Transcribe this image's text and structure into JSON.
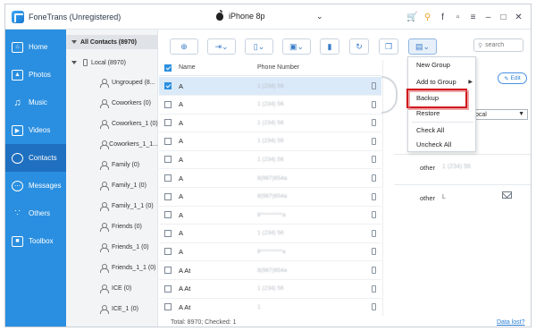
{
  "app": {
    "title": "FoneTrans (Unregistered)",
    "device_name": "iPhone 8p",
    "window_icons": [
      "cart-icon",
      "key-icon",
      "facebook-icon",
      "chat-icon",
      "menu-icon",
      "minimize-icon",
      "maximize-icon",
      "close-icon"
    ]
  },
  "sidebar": {
    "items": [
      {
        "label": "Home",
        "icon": "home-icon",
        "active": false
      },
      {
        "label": "Photos",
        "icon": "photos-icon",
        "active": false
      },
      {
        "label": "Music",
        "icon": "music-icon",
        "active": false
      },
      {
        "label": "Videos",
        "icon": "videos-icon",
        "active": false
      },
      {
        "label": "Contacts",
        "icon": "contacts-icon",
        "active": true
      },
      {
        "label": "Messages",
        "icon": "messages-icon",
        "active": false
      },
      {
        "label": "Others",
        "icon": "others-icon",
        "active": false
      },
      {
        "label": "Toolbox",
        "icon": "toolbox-icon",
        "active": false
      }
    ]
  },
  "tree": {
    "root": "All Contacts  (8970)",
    "local": "Local  (8970)",
    "groups": [
      "Ungrouped  (8...",
      "Coworkers  (0)",
      "Coworkers_1  (0)",
      "Coworkers_1_1...",
      "Family  (0)",
      "Family_1  (0)",
      "Family_1_1  (0)",
      "Friends  (0)",
      "Friends_1  (0)",
      "Friends_1_1  (0)",
      "ICE  (0)",
      "ICE_1  (0)"
    ]
  },
  "toolbar": {
    "tools": [
      "add-icon",
      "import-icon",
      "export-to-device-icon",
      "export-to-pc-icon",
      "delete-icon",
      "refresh-icon",
      "duplicate-icon",
      "toolbox-menu-icon"
    ],
    "search_placeholder": "search"
  },
  "list": {
    "col_name": "Name",
    "col_phone": "Phone Number",
    "rows": [
      {
        "name": "A",
        "phone": "1 (234) 56",
        "checked": true,
        "selected": true
      },
      {
        "name": "A",
        "phone": "1 (234) 56",
        "checked": false,
        "selected": false
      },
      {
        "name": "A",
        "phone": "1 (234) 56",
        "checked": false,
        "selected": false
      },
      {
        "name": "A",
        "phone": "1 (234) 56",
        "checked": false,
        "selected": false
      },
      {
        "name": "A",
        "phone": "1 (234) 56",
        "checked": false,
        "selected": false
      },
      {
        "name": "A",
        "phone": "8(987)654a",
        "checked": false,
        "selected": false
      },
      {
        "name": "A",
        "phone": "8(987)654a",
        "checked": false,
        "selected": false
      },
      {
        "name": "A",
        "phone": "8^^^^^^^^a",
        "checked": false,
        "selected": false
      },
      {
        "name": "A",
        "phone": "1 (234) 56",
        "checked": false,
        "selected": false
      },
      {
        "name": "A",
        "phone": "8^^^^^^^^a",
        "checked": false,
        "selected": false
      },
      {
        "name": "A At",
        "phone": "8(987)654a",
        "checked": false,
        "selected": false
      },
      {
        "name": "A At",
        "phone": "1 (234) 56",
        "checked": false,
        "selected": false
      },
      {
        "name": "A At",
        "phone": "1",
        "checked": false,
        "selected": false
      }
    ]
  },
  "status": {
    "total": "Total: 8970; Checked: 1",
    "data_lost": "Data lost?"
  },
  "detail": {
    "edit": "Edit",
    "group_value": "ocal",
    "fields": [
      {
        "label": "other",
        "value": "1 (234) 56"
      },
      {
        "label": "other",
        "value": "L"
      }
    ]
  },
  "menu": {
    "items": [
      "New Group",
      "Add to Group",
      "Backup",
      "Restore",
      "Check All",
      "Uncheck All"
    ],
    "highlighted": "Backup"
  }
}
